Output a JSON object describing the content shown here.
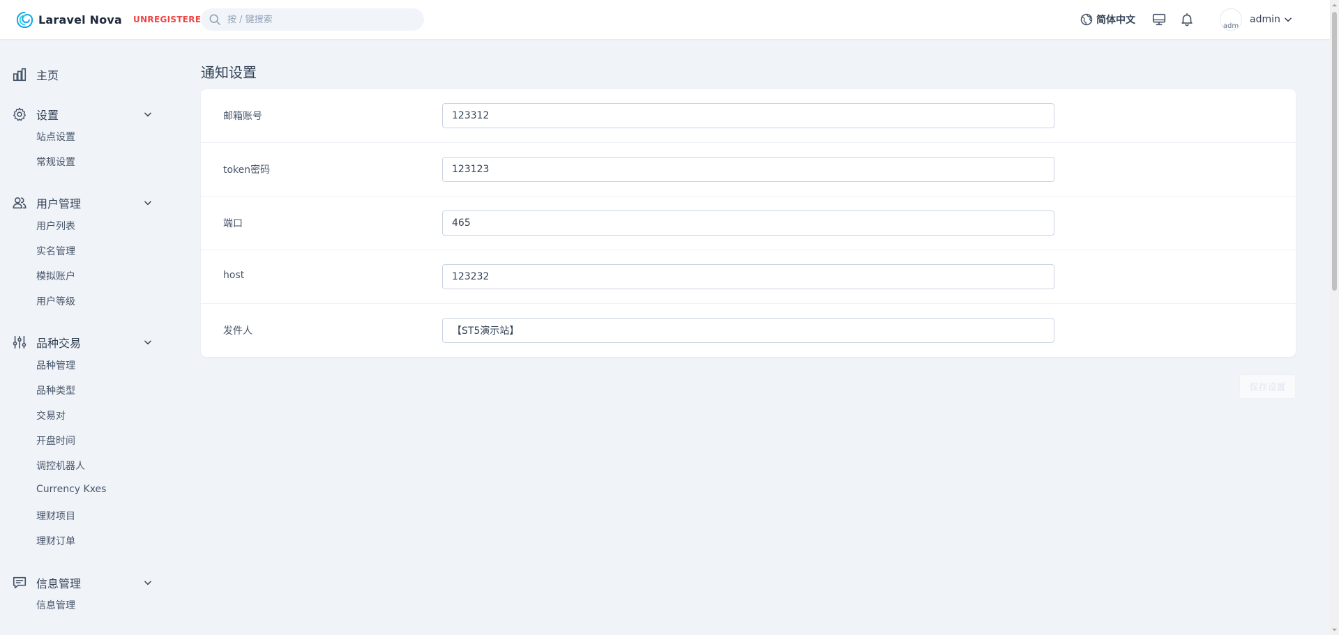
{
  "header": {
    "brand": "Laravel Nova",
    "badge": "UNREGISTERED",
    "search_placeholder": "按 / 键搜索",
    "language": "简体中文",
    "avatar_alt": "adm",
    "username": "admin"
  },
  "sidebar": {
    "home": "主页",
    "groups": [
      {
        "label": "设置",
        "items": [
          "站点设置",
          "常规设置"
        ]
      },
      {
        "label": "用户管理",
        "items": [
          "用户列表",
          "实名管理",
          "模拟账户",
          "用户等级"
        ]
      },
      {
        "label": "品种交易",
        "items": [
          "品种管理",
          "品种类型",
          "交易对",
          "开盘时间",
          "调控机器人",
          "Currency Kxes",
          "理财项目",
          "理财订单"
        ]
      },
      {
        "label": "信息管理",
        "items": [
          "信息管理"
        ]
      }
    ]
  },
  "main": {
    "title": "通知设置",
    "fields": [
      {
        "label": "邮箱账号",
        "value": "123312"
      },
      {
        "label": "token密码",
        "value": "123123"
      },
      {
        "label": "端口",
        "value": "465"
      },
      {
        "label": "host",
        "value": "123232"
      },
      {
        "label": "发件人",
        "value": "【ST5演示站】"
      }
    ],
    "save_label": "保存设置"
  },
  "colors": {
    "accent": "#0ea5e9",
    "badge": "#ef4444",
    "background": "#f0f4f9"
  }
}
